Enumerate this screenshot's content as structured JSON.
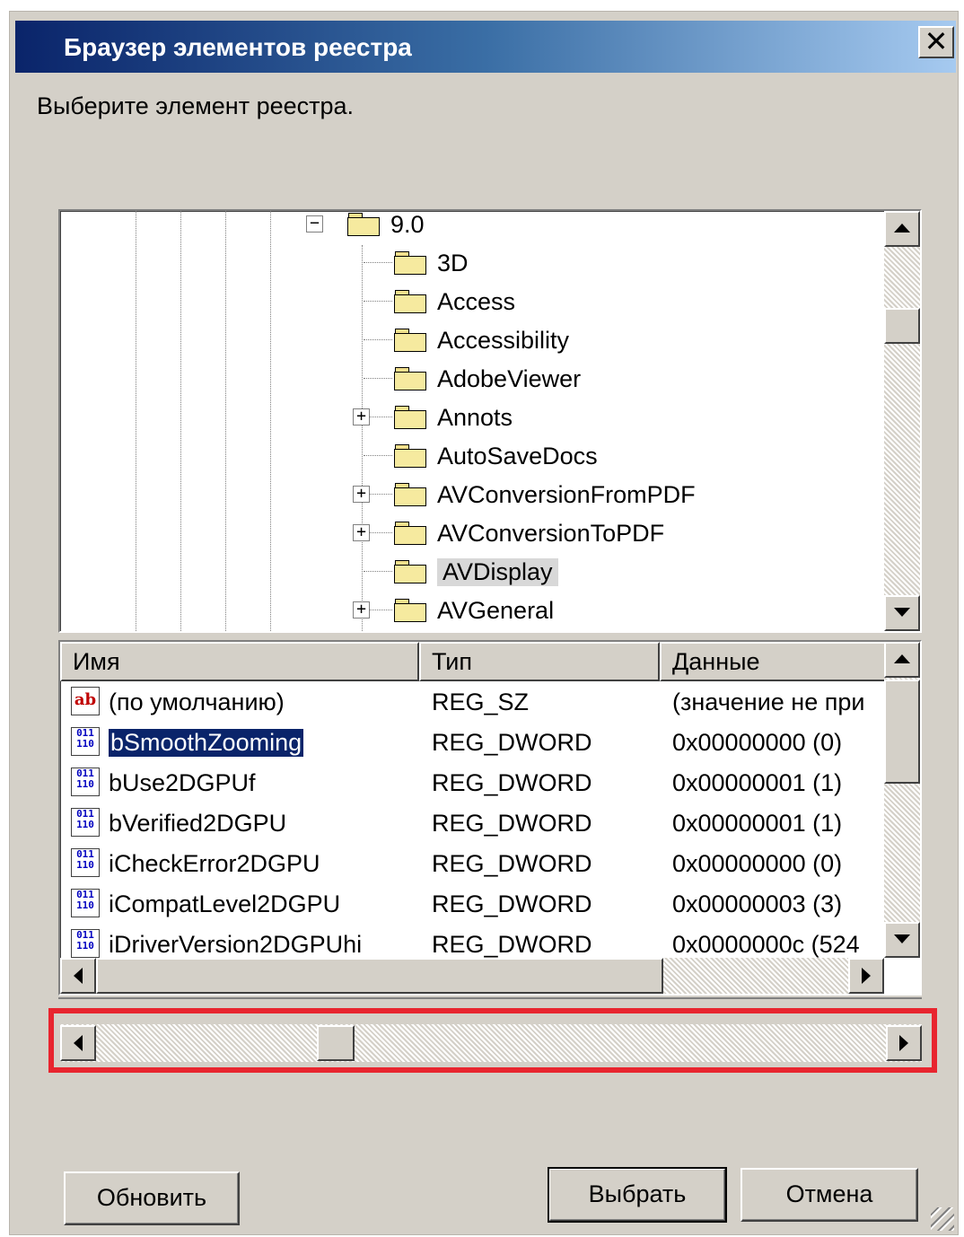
{
  "window": {
    "title": "Браузер элементов реестра",
    "close_glyph": "✕"
  },
  "prompt": "Выберите элемент реестра.",
  "tree": {
    "items": [
      {
        "label": "9.0",
        "expander": "−"
      },
      {
        "label": "3D",
        "expander": ""
      },
      {
        "label": "Access",
        "expander": ""
      },
      {
        "label": "Accessibility",
        "expander": ""
      },
      {
        "label": "AdobeViewer",
        "expander": ""
      },
      {
        "label": "Annots",
        "expander": "+"
      },
      {
        "label": "AutoSaveDocs",
        "expander": ""
      },
      {
        "label": "AVConversionFromPDF",
        "expander": "+"
      },
      {
        "label": "AVConversionToPDF",
        "expander": "+"
      },
      {
        "label": "AVDisplay",
        "expander": "",
        "selected": true
      },
      {
        "label": "AVGeneral",
        "expander": "+"
      }
    ]
  },
  "values_list": {
    "columns": [
      "Имя",
      "Тип",
      "Данные"
    ],
    "rows": [
      {
        "icon": "string-value-icon",
        "name": "(по умолчанию)",
        "type": "REG_SZ",
        "data": "(значение не при"
      },
      {
        "icon": "binary-value-icon",
        "name": "bSmoothZooming",
        "type": "REG_DWORD",
        "data": "0x00000000 (0)",
        "selected": true
      },
      {
        "icon": "binary-value-icon",
        "name": "bUse2DGPUf",
        "type": "REG_DWORD",
        "data": "0x00000001 (1)"
      },
      {
        "icon": "binary-value-icon",
        "name": "bVerified2DGPU",
        "type": "REG_DWORD",
        "data": "0x00000001 (1)"
      },
      {
        "icon": "binary-value-icon",
        "name": "iCheckError2DGPU",
        "type": "REG_DWORD",
        "data": "0x00000000 (0)"
      },
      {
        "icon": "binary-value-icon",
        "name": "iCompatLevel2DGPU",
        "type": "REG_DWORD",
        "data": "0x00000003 (3)"
      },
      {
        "icon": "binary-value-icon",
        "name": "iDriverVersion2DGPUhi",
        "type": "REG_DWORD",
        "data": "0x0000000c (524"
      }
    ]
  },
  "icons": {
    "sz": "ab",
    "dword": "011\n110"
  },
  "highlight_color": "#e8252f",
  "buttons": {
    "refresh": "Обновить",
    "select": "Выбрать",
    "cancel": "Отмена"
  }
}
